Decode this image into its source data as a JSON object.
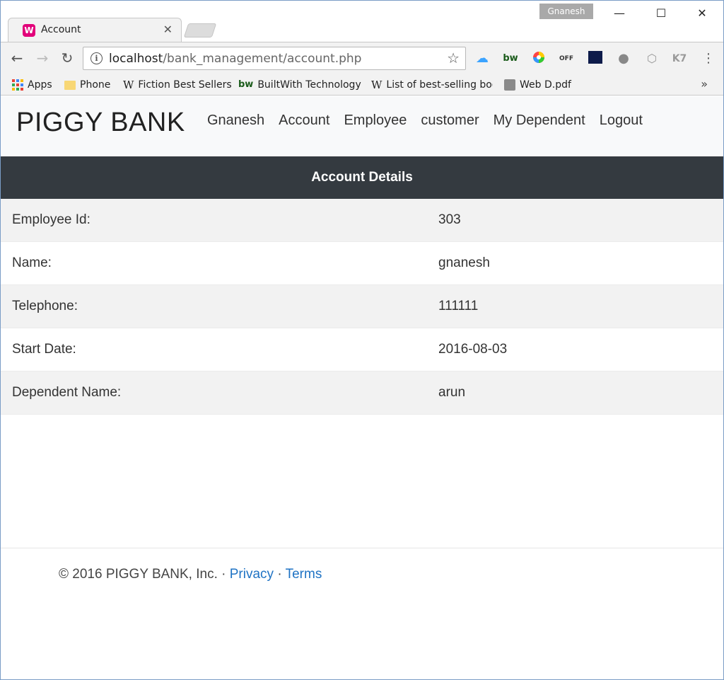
{
  "browser": {
    "tab_title": "Account",
    "profile_name": "Gnanesh",
    "url_host": "localhost",
    "url_path": "/bank_management/account.php",
    "bookmarks": [
      {
        "label": "Apps",
        "icon": "apps-grid-icon"
      },
      {
        "label": "Phone",
        "icon": "folder-icon"
      },
      {
        "label": "Fiction Best Sellers",
        "icon": "wikipedia-icon"
      },
      {
        "label": "BuiltWith Technology",
        "icon": "builtwith-icon"
      },
      {
        "label": "List of best-selling boo",
        "icon": "wikipedia-icon"
      },
      {
        "label": "Web D.pdf",
        "icon": "pdf-icon"
      }
    ],
    "more_bookmarks": "»"
  },
  "navbar": {
    "brand": "PIGGY BANK",
    "links": [
      "Gnanesh",
      "Account",
      "Employee",
      "customer",
      "My Dependent",
      "Logout"
    ]
  },
  "account": {
    "header": "Account Details",
    "rows": [
      {
        "label": "Employee Id:",
        "value": "303"
      },
      {
        "label": "Name:",
        "value": "gnanesh"
      },
      {
        "label": "Telephone:",
        "value": "111111"
      },
      {
        "label": "Start Date:",
        "value": "2016-08-03"
      },
      {
        "label": "Dependent Name:",
        "value": "arun"
      }
    ]
  },
  "footer": {
    "copyright": "© 2016 PIGGY BANK, Inc. · ",
    "privacy": "Privacy",
    "separator": " · ",
    "terms": "Terms"
  }
}
